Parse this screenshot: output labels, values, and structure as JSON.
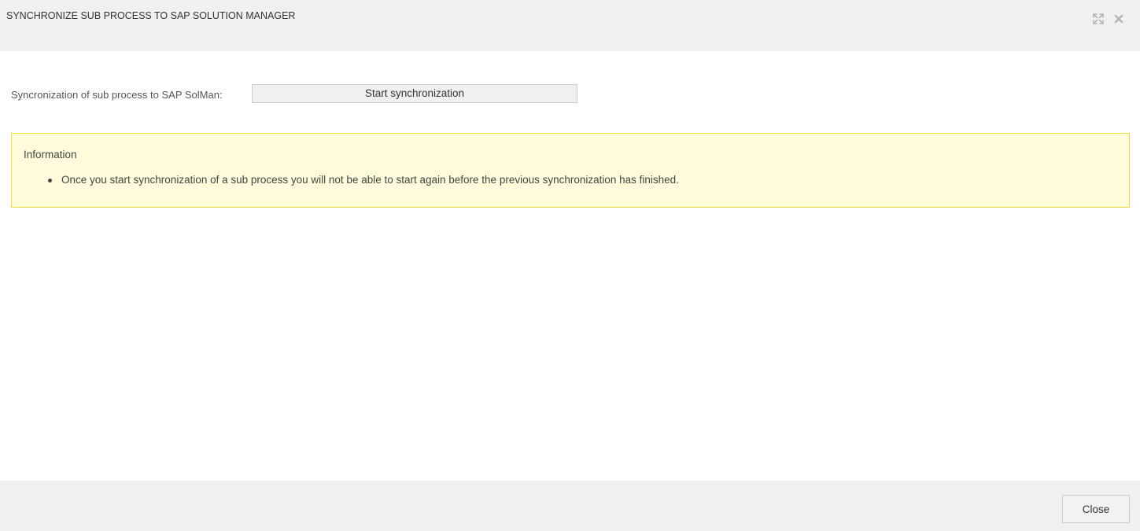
{
  "dialog": {
    "title": "SYNCHRONIZE SUB PROCESS TO SAP SOLUTION MANAGER",
    "icons": {
      "maximize": "maximize-icon",
      "close": "close-icon"
    }
  },
  "sync": {
    "label": "Syncronization of sub process to SAP SolMan:",
    "button_label": "Start synchronization"
  },
  "info": {
    "title": "Information",
    "items": [
      "Once you start synchronization of a sub process you will not be able to start again before the previous synchronization has finished."
    ]
  },
  "footer": {
    "close_label": "Close"
  },
  "colors": {
    "header_bg": "#f0f0f0",
    "info_bg": "#fffbdb",
    "info_border": "#f0dc3a",
    "icon": "#b5b5b5"
  }
}
